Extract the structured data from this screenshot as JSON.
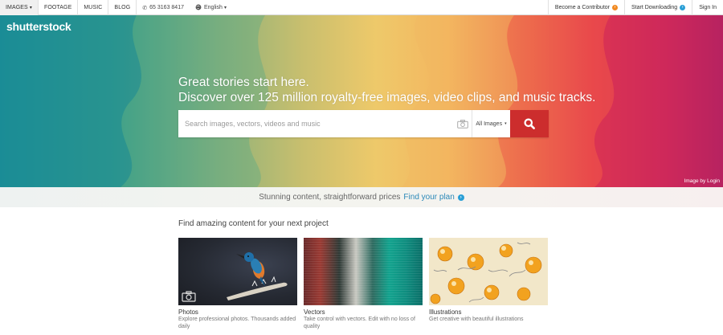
{
  "topbar": {
    "nav": [
      {
        "label": "IMAGES",
        "active": true,
        "caret": true
      },
      {
        "label": "FOOTAGE",
        "active": false
      },
      {
        "label": "MUSIC",
        "active": false
      },
      {
        "label": "BLOG",
        "active": false
      }
    ],
    "phone": "65 3163 8417",
    "language": "English",
    "contributor_label": "Become a Contributor",
    "downloading_label": "Start Downloading",
    "signin_label": "Sign In"
  },
  "hero": {
    "logo": "shutterstock",
    "headline_line1": "Great stories start here.",
    "headline_line2": "Discover over 125 million royalty-free images, video clips, and music tracks.",
    "search_placeholder": "Search images, vectors, videos and music",
    "search_value": "",
    "media_select": "All Images",
    "credit": "Image by Login"
  },
  "pricing": {
    "text": "Stunning content, straightforward prices",
    "link": "Find your plan"
  },
  "content": {
    "title": "Find amazing content for your next project",
    "cards": [
      {
        "name": "Photos",
        "desc": "Explore professional photos. Thousands added daily"
      },
      {
        "name": "Vectors",
        "desc": "Take control with vectors. Edit with no loss of quality"
      },
      {
        "name": "Illustrations",
        "desc": "Get creative with beautiful illustrations"
      }
    ]
  },
  "colors": {
    "search_button": "#cc2d2d",
    "link_blue": "#2a88b8",
    "contributor_badge": "#f18a21",
    "downloading_badge": "#2a9fd6"
  },
  "icons": [
    "phone-icon",
    "globe-icon",
    "camera-icon",
    "search-icon",
    "arrow-right-icon"
  ]
}
